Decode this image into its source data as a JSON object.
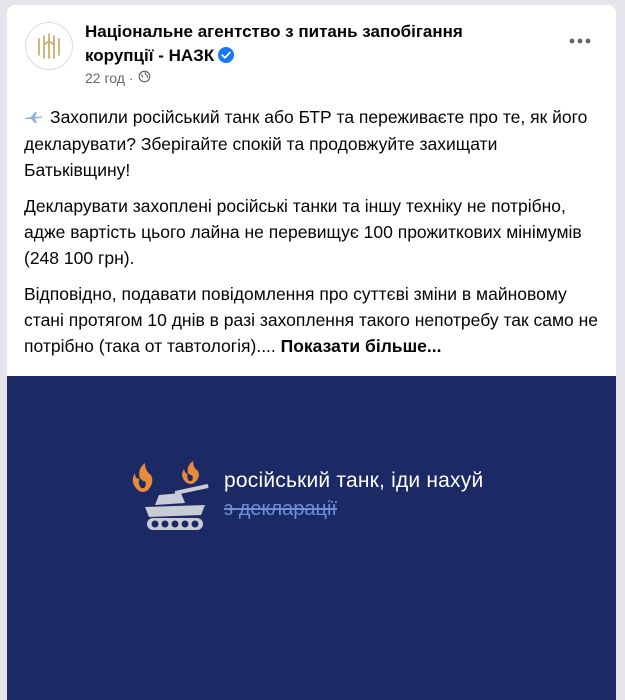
{
  "post": {
    "page_name": "Національне агентство з питань запобігання корупції - НАЗК",
    "verified": true,
    "timestamp": "22 год",
    "separator": "·",
    "privacy_icon": "globe-icon",
    "more_icon": "more-options-icon",
    "paragraph1": "Захопили російський танк або БТР та переживаєте про те, як його декларувати? Зберігайте спокій та продовжуйте захищати Батьківщину!",
    "paragraph2": "Декларувати захоплені російські танки та іншу техніку не потрібно, адже вартість цього лайна не перевищує 100 прожиткових мінімумів (248 100 грн).",
    "paragraph3": "Відповідно, подавати повідомлення про суттєві зміни в майновому стані протягом 10 днів в разі захоплення такого непотребу так само не потрібно (така от тавтологія)....",
    "see_more": "Показати більше..."
  },
  "media": {
    "line1": "російський танк, іди нахуй",
    "line2": "з декларації",
    "background": "#1b2a64",
    "accent_orange": "#e88a3c",
    "tank_color": "#c9ccd4"
  },
  "colors": {
    "meta_text": "#65676b",
    "verified_badge": "#1877f2"
  }
}
